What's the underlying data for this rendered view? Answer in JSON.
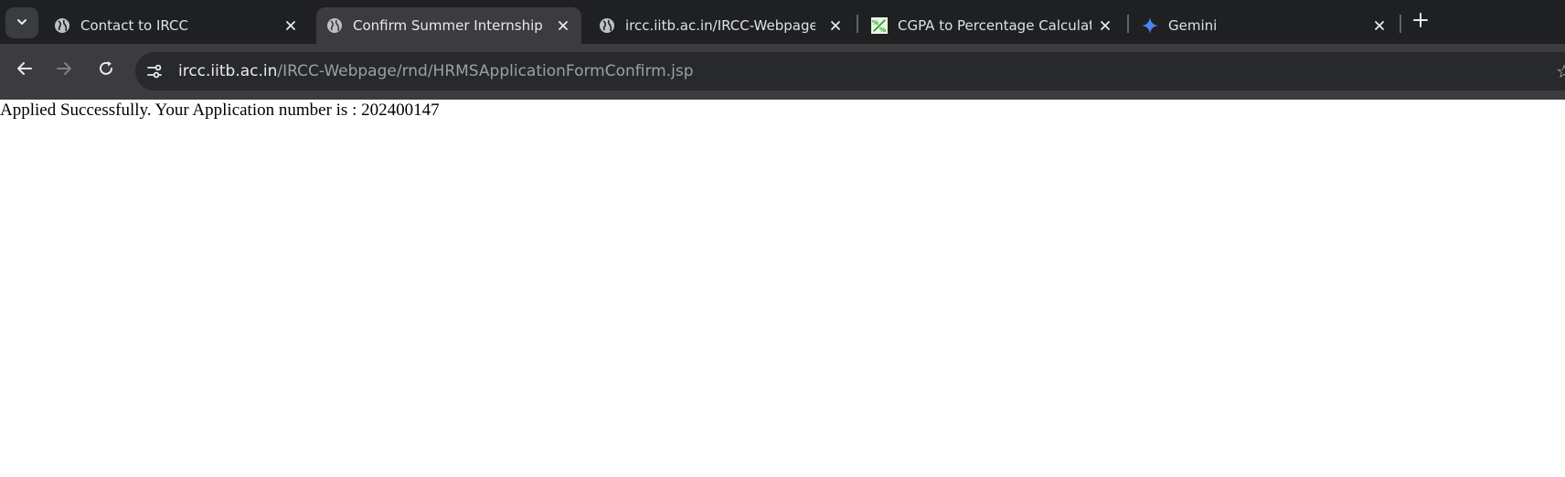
{
  "browser": {
    "tabs": [
      {
        "title": "Contact to IRCC",
        "favicon": "globe-icon",
        "active": false
      },
      {
        "title": "Confirm Summer Internship",
        "favicon": "globe-icon",
        "active": true
      },
      {
        "title": "ircc.iitb.ac.in/IRCC-Webpage/IIT",
        "favicon": "globe-icon",
        "active": false
      },
      {
        "title": "CGPA to Percentage Calculator",
        "favicon": "percent-calculator-icon",
        "active": false
      },
      {
        "title": "Gemini",
        "favicon": "gemini-sparkle-icon",
        "active": false
      }
    ],
    "address_bar": {
      "host": "ircc.iitb.ac.in",
      "path": "/IRCC-Webpage/rnd/HRMSApplicationFormConfirm.jsp"
    },
    "colors": {
      "tabstrip": "#1f2022",
      "toolbar": "#3c3c3f",
      "omnibox": "#28292b",
      "gemini_accent": "#4a86f0",
      "calc_favicon": "#2e9d3a"
    }
  },
  "page": {
    "message": "Applied Successfully. Your Application number is : 202400147"
  }
}
